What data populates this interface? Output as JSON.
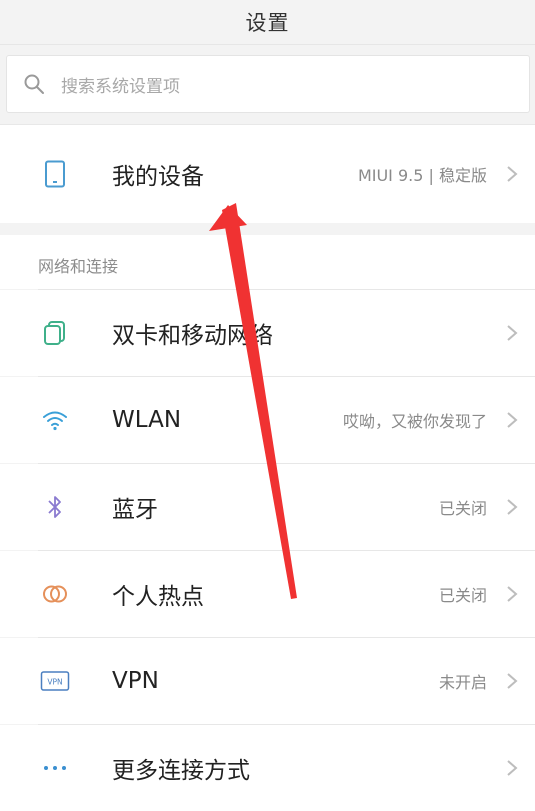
{
  "header": {
    "title": "设置"
  },
  "search": {
    "placeholder": "搜索系统设置项"
  },
  "device": {
    "label": "我的设备",
    "value": "MIUI 9.5 | 稳定版"
  },
  "section": {
    "title": "网络和连接"
  },
  "items": [
    {
      "label": "双卡和移动网络",
      "value": "",
      "icon": "sim-cards-icon"
    },
    {
      "label": "WLAN",
      "value": "哎呦，又被你发现了",
      "icon": "wifi-icon"
    },
    {
      "label": "蓝牙",
      "value": "已关闭",
      "icon": "bluetooth-icon"
    },
    {
      "label": "个人热点",
      "value": "已关闭",
      "icon": "hotspot-icon"
    },
    {
      "label": "VPN",
      "value": "未开启",
      "icon": "vpn-icon"
    },
    {
      "label": "更多连接方式",
      "value": "",
      "icon": "more-dots-icon"
    }
  ],
  "vpn_icon_text": "VPN",
  "colors": {
    "arrow": "#f03232",
    "accent": "#3aa0d8"
  }
}
